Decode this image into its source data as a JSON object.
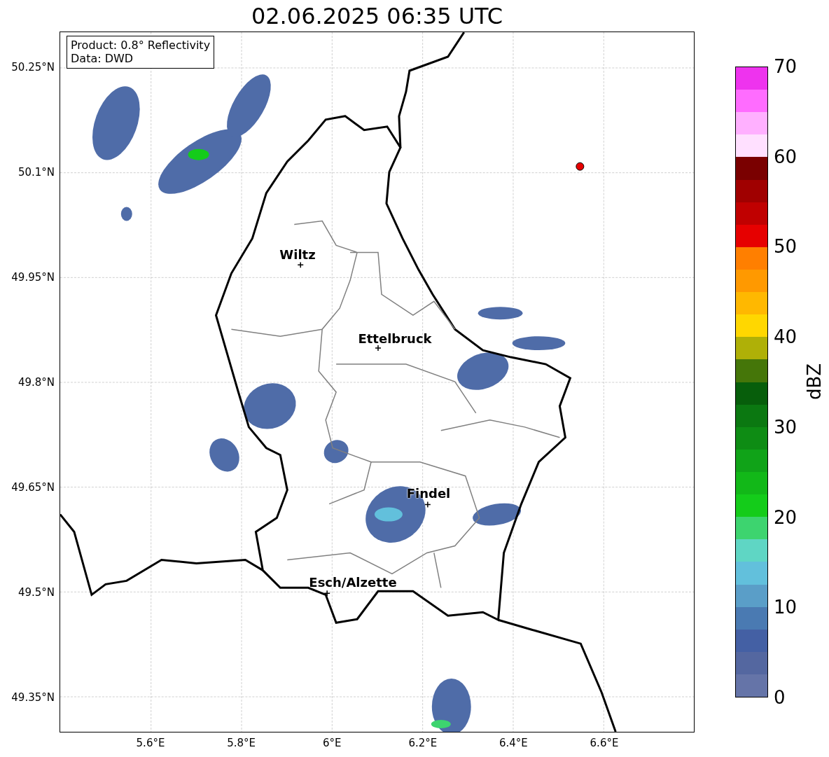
{
  "title": "02.06.2025 06:35 UTC",
  "legend": [
    "Product: 0.8° Reflectivity",
    "Data: DWD"
  ],
  "map": {
    "cities": [
      {
        "label": "Wiltz"
      },
      {
        "label": "Ettelbruck"
      },
      {
        "label": "Findel"
      },
      {
        "label": "Esch/Alzette"
      }
    ],
    "yticks": [
      "50.25°N",
      "50.1°N",
      "49.95°N",
      "49.8°N",
      "49.65°N",
      "49.5°N",
      "49.35°N"
    ],
    "xticks": [
      "5.6°E",
      "5.8°E",
      "6°E",
      "6.2°E",
      "6.4°E",
      "6.6°E"
    ]
  },
  "colorbar": {
    "label": "dBZ",
    "ticks": [
      "70",
      "60",
      "50",
      "40",
      "30",
      "20",
      "10",
      "0"
    ],
    "segments": [
      {
        "color": "#6574a8"
      },
      {
        "color": "#5467a0"
      },
      {
        "color": "#4460a4"
      },
      {
        "color": "#4a7ab2"
      },
      {
        "color": "#5a9ec8"
      },
      {
        "color": "#62c0dc"
      },
      {
        "color": "#5fd6c4"
      },
      {
        "color": "#3dd46f"
      },
      {
        "color": "#14cc1a"
      },
      {
        "color": "#12b818"
      },
      {
        "color": "#10a318"
      },
      {
        "color": "#0e8c14"
      },
      {
        "color": "#0b7811"
      },
      {
        "color": "#075e0b"
      },
      {
        "color": "#457609"
      },
      {
        "color": "#afb007"
      },
      {
        "color": "#ffd700"
      },
      {
        "color": "#ffb800"
      },
      {
        "color": "#ff9900"
      },
      {
        "color": "#ff7f00"
      },
      {
        "color": "#e60000"
      },
      {
        "color": "#c00000"
      },
      {
        "color": "#a00000"
      },
      {
        "color": "#7a0000"
      },
      {
        "color": "#ffe0ff"
      },
      {
        "color": "#ffb0ff"
      },
      {
        "color": "#ff6cff"
      },
      {
        "color": "#ee33ee"
      }
    ]
  }
}
